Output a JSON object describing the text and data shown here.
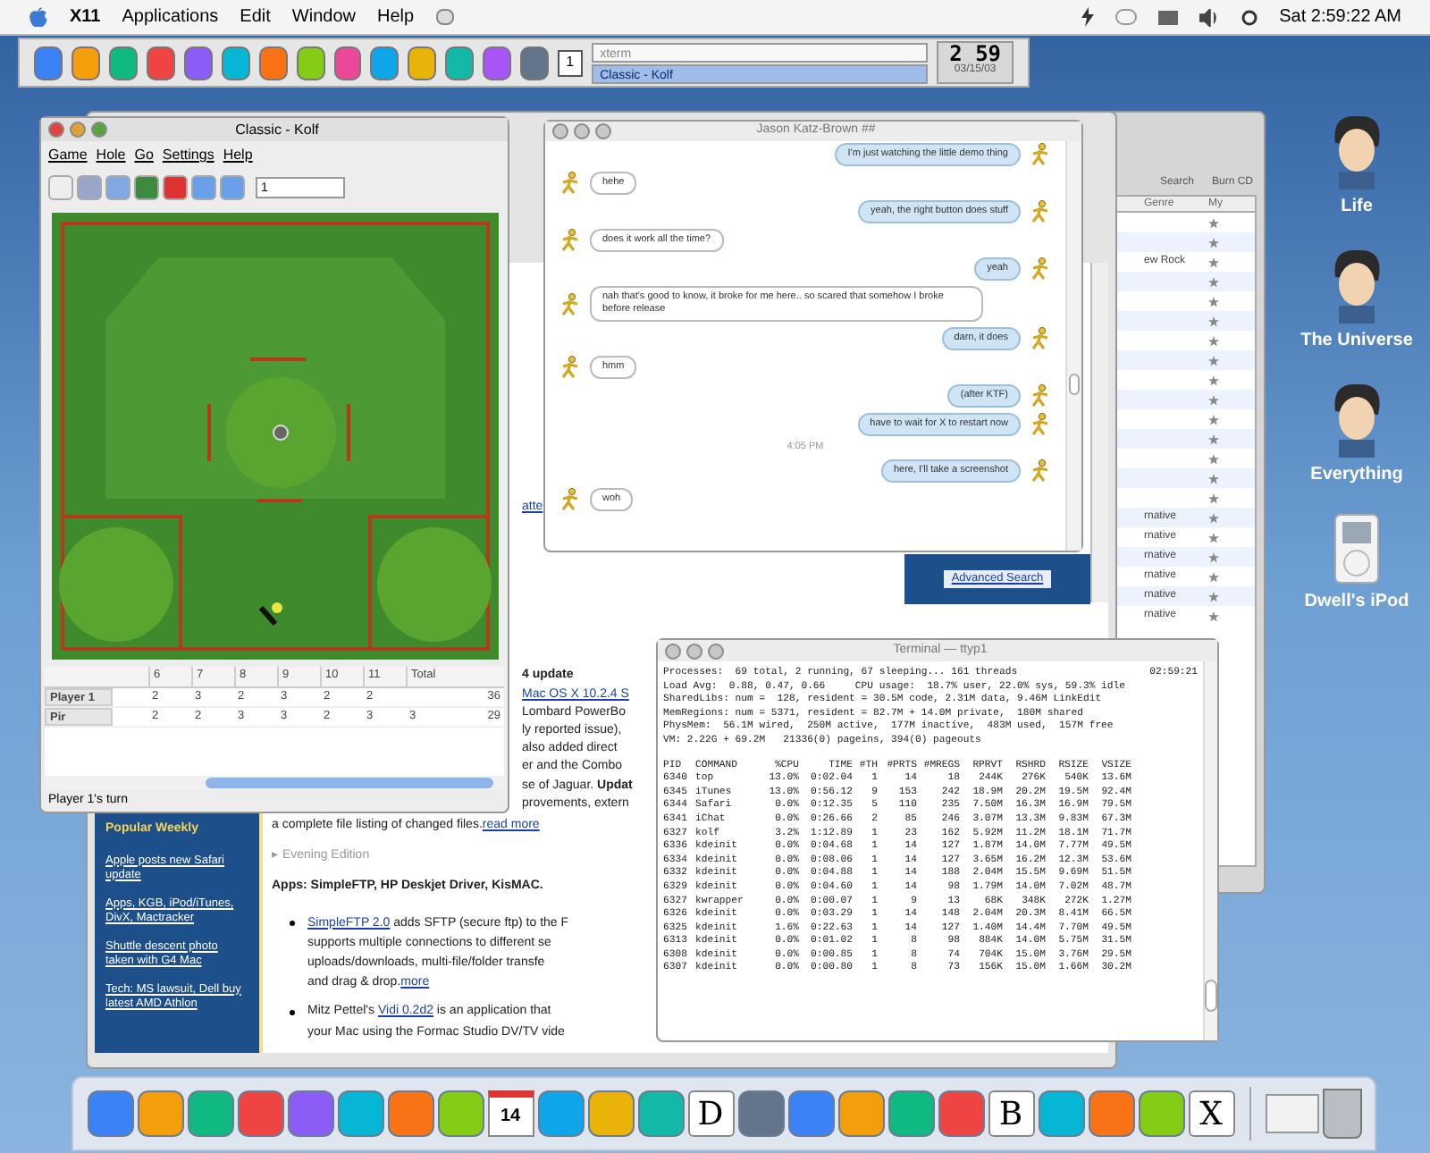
{
  "menubar": {
    "app": "X11",
    "items": [
      "Applications",
      "Edit",
      "Window",
      "Help"
    ],
    "clock": "Sat 2:59:22 AM"
  },
  "panel": {
    "pager": "1",
    "tasks": [
      {
        "label": "xterm",
        "selected": false
      },
      {
        "label": "Classic - Kolf",
        "selected": true
      }
    ],
    "clock": "2 59",
    "date": "03/15/03"
  },
  "desktop_icons": [
    {
      "kind": "person",
      "label": "Life"
    },
    {
      "kind": "person",
      "label": "The Universe"
    },
    {
      "kind": "person",
      "label": "Everything"
    },
    {
      "kind": "ipod",
      "label": "Dwell's iPod"
    }
  ],
  "itunes": {
    "buttons": [
      "Search",
      "Burn CD"
    ],
    "columns": [
      "Genre",
      "My"
    ],
    "upper_genres": [
      "ew Rock"
    ],
    "lower_genres": [
      "rnative",
      "rnative",
      "rnative",
      "rnative",
      "rnative",
      "rnative"
    ]
  },
  "browser": {
    "link_fragment": "atte",
    "right_link": "Advanced Search",
    "beside_lines": [
      {
        "parts": [
          {
            "kind": "bold",
            "text": "4 update"
          }
        ]
      },
      {
        "parts": [
          {
            "kind": "link",
            "text": "Mac OS X 10.2.4 S"
          }
        ]
      },
      {
        "parts": [
          {
            "kind": "text",
            "text": "Lombard PowerBo"
          }
        ]
      },
      {
        "parts": [
          {
            "kind": "text",
            "text": "ly reported issue), "
          }
        ]
      },
      {
        "parts": [
          {
            "kind": "text",
            "text": "also added direct "
          }
        ]
      },
      {
        "parts": [
          {
            "kind": "text",
            "text": "er and the Combo "
          }
        ]
      },
      {
        "parts": [
          {
            "kind": "text",
            "text": "se of Jaguar. "
          },
          {
            "kind": "bold",
            "text": "Updat"
          }
        ]
      },
      {
        "parts": [
          {
            "kind": "text",
            "text": "provements, extern"
          }
        ]
      }
    ],
    "lines": [
      {
        "kind": "text",
        "parts": [
          {
            "kind": "text",
            "text": "a complete file listing of changed files."
          },
          {
            "kind": "link",
            "text": "read more"
          }
        ]
      },
      {
        "kind": "section",
        "parts": [
          {
            "kind": "text",
            "text": "▸ Evening Edition"
          }
        ]
      },
      {
        "kind": "heading",
        "parts": [
          {
            "kind": "bold",
            "text": "Apps: SimpleFTP, HP Deskjet Driver, KisMAC."
          }
        ]
      },
      {
        "kind": "bullet",
        "parts": [
          {
            "kind": "link",
            "text": "SimpleFTP 2.0"
          },
          {
            "kind": "text",
            "text": " adds SFTP (secure ftp) to the F"
          }
        ]
      },
      {
        "kind": "continuation",
        "parts": [
          {
            "kind": "text",
            "text": "supports multiple connections to different se"
          }
        ]
      },
      {
        "kind": "continuation",
        "parts": [
          {
            "kind": "text",
            "text": "uploads/downloads, multi-file/folder transfe"
          }
        ]
      },
      {
        "kind": "continuation",
        "parts": [
          {
            "kind": "text",
            "text": "and drag & drop."
          },
          {
            "kind": "link",
            "text": "more"
          }
        ]
      },
      {
        "kind": "bullet",
        "parts": [
          {
            "kind": "text",
            "text": "Mitz Pettel's "
          },
          {
            "kind": "link",
            "text": "Vidi 0.2d2"
          },
          {
            "kind": "text",
            "text": " is an application that"
          }
        ]
      },
      {
        "kind": "continuation",
        "parts": [
          {
            "kind": "text",
            "text": "your Mac using the Formac Studio DV/TV vide"
          }
        ]
      }
    ],
    "sidebar": {
      "heading": "Popular Weekly",
      "links": [
        "Apple posts new Safari update",
        "Apps, KGB, iPod/iTunes, DivX, Mactracker",
        "Shuttle descent photo taken with G4 Mac",
        "Tech: MS lawsuit, Dell buy latest AMD Athlon"
      ]
    }
  },
  "kolf": {
    "title": "Classic - Kolf",
    "active": true,
    "menu": [
      "Game",
      "Hole",
      "Go",
      "Settings",
      "Help"
    ],
    "hole": "1",
    "columns": [
      "6",
      "7",
      "8",
      "9",
      "10",
      "11",
      "Total"
    ],
    "rows": [
      {
        "name": "Player 1",
        "cells": [
          "2",
          "3",
          "2",
          "3",
          "2",
          "2",
          "",
          "36"
        ]
      },
      {
        "name": "Pir",
        "cells": [
          "2",
          "2",
          "3",
          "3",
          "2",
          "3",
          "3",
          "29"
        ]
      }
    ],
    "status": "Player 1's turn"
  },
  "chat": {
    "title": "Jason Katz-Brown ##",
    "active": false,
    "messages": [
      {
        "kind": "sent",
        "text": "I'm just watching the little demo thing"
      },
      {
        "kind": "received",
        "text": "hehe"
      },
      {
        "kind": "sent",
        "text": "yeah, the right button does stuff"
      },
      {
        "kind": "received",
        "text": "does it work all the time?"
      },
      {
        "kind": "sent",
        "text": "yeah"
      },
      {
        "kind": "received",
        "text": "nah that's good to know, it broke for me here.. so scared that somehow I broke before release"
      },
      {
        "kind": "sent",
        "text": "darn, it does"
      },
      {
        "kind": "received",
        "text": "hmm"
      },
      {
        "kind": "sent",
        "text": "(after KTF)"
      },
      {
        "kind": "sent",
        "text": "have to wait for X to restart now"
      },
      {
        "kind": "time",
        "text": "4:05 PM"
      },
      {
        "kind": "sent",
        "text": "here, I'll take a screenshot"
      },
      {
        "kind": "received",
        "text": "woh"
      }
    ]
  },
  "terminal": {
    "title": "Terminal — ttyp1",
    "active": false,
    "time": "02:59:21",
    "summary": [
      "Processes:  69 total, 2 running, 67 sleeping... 161 threads",
      "Load Avg:  0.88, 0.47, 0.66     CPU usage:  18.7% user, 22.0% sys, 59.3% idle",
      "SharedLibs: num =  128, resident = 30.5M code, 2.31M data, 9.46M LinkEdit",
      "MemRegions: num = 5371, resident = 82.7M + 14.0M private,  180M shared",
      "PhysMem:  56.1M wired,  250M active,  177M inactive,  483M used,  157M free",
      "VM: 2.22G + 69.2M   21336(0) pageins, 394(0) pageouts"
    ],
    "columns": [
      "PID",
      "COMMAND",
      "%CPU",
      "TIME",
      "#TH",
      "#PRTS",
      "#MREGS",
      "RPRVT",
      "RSHRD",
      "RSIZE",
      "VSIZE"
    ],
    "rows": [
      [
        "6340",
        "top",
        "13.0%",
        "0:02.04",
        "1",
        "14",
        "18",
        "244K",
        "276K",
        "540K",
        "13.6M"
      ],
      [
        "6345",
        "iTunes",
        "13.0%",
        "0:56.12",
        "9",
        "153",
        "242",
        "18.9M",
        "20.2M",
        "19.5M",
        "92.4M"
      ],
      [
        "6344",
        "Safari",
        "0.0%",
        "0:12.35",
        "5",
        "110",
        "235",
        "7.50M",
        "16.3M",
        "16.9M",
        "79.5M"
      ],
      [
        "6341",
        "iChat",
        "0.0%",
        "0:26.66",
        "2",
        "85",
        "246",
        "3.07M",
        "13.3M",
        "9.83M",
        "67.3M"
      ],
      [
        "6327",
        "kolf",
        "3.2%",
        "1:12.89",
        "1",
        "23",
        "162",
        "5.92M",
        "11.2M",
        "18.1M",
        "71.7M"
      ],
      [
        "6336",
        "kdeinit",
        "0.0%",
        "0:04.68",
        "1",
        "14",
        "127",
        "1.87M",
        "14.0M",
        "7.77M",
        "49.5M"
      ],
      [
        "6334",
        "kdeinit",
        "0.0%",
        "0:08.06",
        "1",
        "14",
        "127",
        "3.65M",
        "16.2M",
        "12.3M",
        "53.6M"
      ],
      [
        "6332",
        "kdeinit",
        "0.0%",
        "0:04.88",
        "1",
        "14",
        "188",
        "2.04M",
        "15.5M",
        "9.69M",
        "51.5M"
      ],
      [
        "6329",
        "kdeinit",
        "0.0%",
        "0:04.60",
        "1",
        "14",
        "98",
        "1.79M",
        "14.0M",
        "7.02M",
        "48.7M"
      ],
      [
        "6327",
        "kwrapper",
        "0.0%",
        "0:00.07",
        "1",
        "9",
        "13",
        "68K",
        "348K",
        "272K",
        "1.27M"
      ],
      [
        "6326",
        "kdeinit",
        "0.0%",
        "0:03.29",
        "1",
        "14",
        "148",
        "2.04M",
        "20.3M",
        "8.41M",
        "66.5M"
      ],
      [
        "6325",
        "kdeinit",
        "1.6%",
        "0:22.63",
        "1",
        "14",
        "127",
        "1.40M",
        "14.4M",
        "7.70M",
        "49.5M"
      ],
      [
        "6313",
        "kdeinit",
        "0.0%",
        "0:01.02",
        "1",
        "8",
        "98",
        "884K",
        "14.0M",
        "5.75M",
        "31.5M"
      ],
      [
        "6308",
        "kdeinit",
        "0.0%",
        "0:00.85",
        "1",
        "8",
        "74",
        "704K",
        "15.0M",
        "3.76M",
        "29.5M"
      ],
      [
        "6307",
        "kdeinit",
        "0.0%",
        "0:00.80",
        "1",
        "8",
        "73",
        "156K",
        "15.0M",
        "1.66M",
        "30.2M"
      ]
    ]
  },
  "dock": {
    "items": [
      {
        "kind": "app"
      },
      {
        "kind": "app"
      },
      {
        "kind": "app"
      },
      {
        "kind": "app"
      },
      {
        "kind": "app"
      },
      {
        "kind": "app"
      },
      {
        "kind": "app"
      },
      {
        "kind": "app"
      },
      {
        "kind": "calendar",
        "label": "14"
      },
      {
        "kind": "app"
      },
      {
        "kind": "app"
      },
      {
        "kind": "app"
      },
      {
        "kind": "letter",
        "label": "D"
      },
      {
        "kind": "app"
      },
      {
        "kind": "app"
      },
      {
        "kind": "app"
      },
      {
        "kind": "app"
      },
      {
        "kind": "app"
      },
      {
        "kind": "letter",
        "label": "B"
      },
      {
        "kind": "app"
      },
      {
        "kind": "app"
      },
      {
        "kind": "app"
      },
      {
        "kind": "letter",
        "label": "X"
      },
      {
        "kind": "separator"
      },
      {
        "kind": "folder"
      },
      {
        "kind": "trash"
      }
    ]
  }
}
